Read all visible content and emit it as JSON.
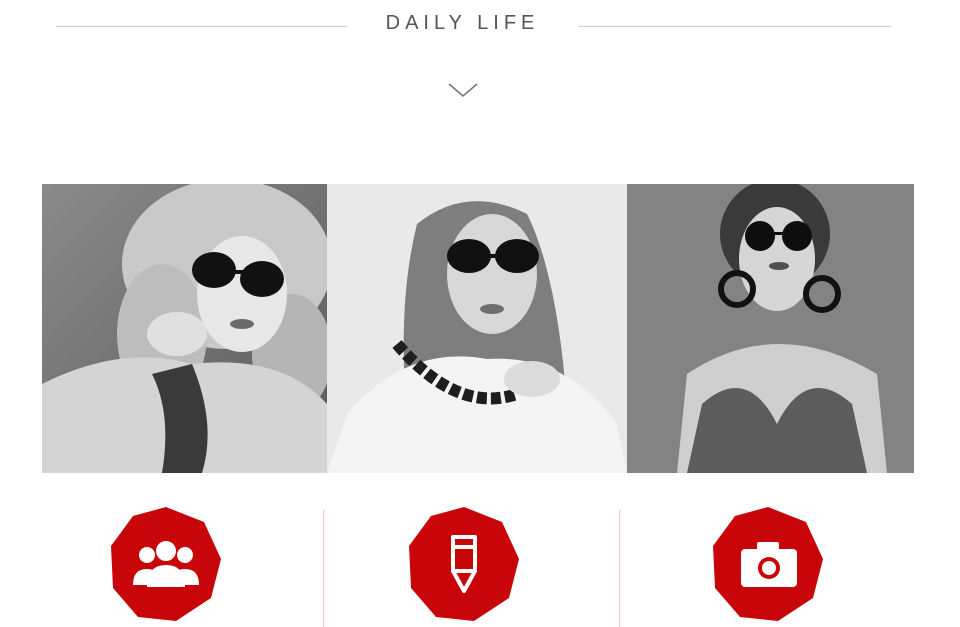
{
  "section": {
    "title": "DAILY LIFE",
    "scroll_hint_icon": "chevron-down-icon"
  },
  "gallery": {
    "photos": [
      {
        "name": "photo-woman-curly-hair-sunglasses"
      },
      {
        "name": "photo-woman-long-hair-sunglasses-necklace"
      },
      {
        "name": "photo-woman-round-sunglasses-earrings"
      }
    ],
    "style": "grayscale"
  },
  "features": {
    "items": [
      {
        "icon": "users-group-icon"
      },
      {
        "icon": "pencil-icon"
      },
      {
        "icon": "camera-icon"
      }
    ],
    "badge_color": "#c8060a",
    "separator_color": "#f2c9c9"
  }
}
